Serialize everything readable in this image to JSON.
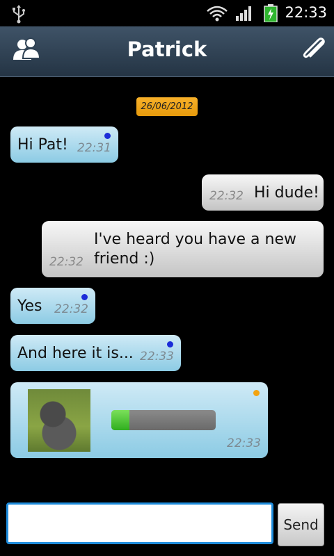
{
  "status_bar": {
    "time": "22:33",
    "icons": [
      "usb-icon",
      "wifi-icon",
      "signal-icon",
      "battery-charging-icon"
    ]
  },
  "header": {
    "title": "Patrick",
    "left_icon": "contacts-icon",
    "right_icon": "paperclip-icon"
  },
  "date_separator": "26/06/2012",
  "messages": [
    {
      "direction": "in",
      "text": "Hi Pat!",
      "time": "22:31",
      "indicator": "blue"
    },
    {
      "direction": "out",
      "text": "Hi dude!",
      "time": "22:32"
    },
    {
      "direction": "out",
      "text_lines": [
        "I've heard you have a new",
        "friend :)"
      ],
      "time": "22:32"
    },
    {
      "direction": "in",
      "text": "Yes",
      "time": "22:32",
      "indicator": "blue"
    },
    {
      "direction": "in",
      "text": "And here it is...",
      "time": "22:33",
      "indicator": "blue"
    },
    {
      "direction": "in",
      "type": "image",
      "time": "22:33",
      "indicator": "orange",
      "upload_progress": 0.17
    }
  ],
  "composer": {
    "value": "",
    "placeholder": "",
    "send_label": "Send"
  },
  "colors": {
    "incoming_bubble": "#a9dbee",
    "outgoing_bubble": "#dcdcdc",
    "header": "#2f4254",
    "date_pill": "#f0a41c",
    "input_border": "#1e8cdc",
    "progress_fill": "#3fc22c"
  }
}
